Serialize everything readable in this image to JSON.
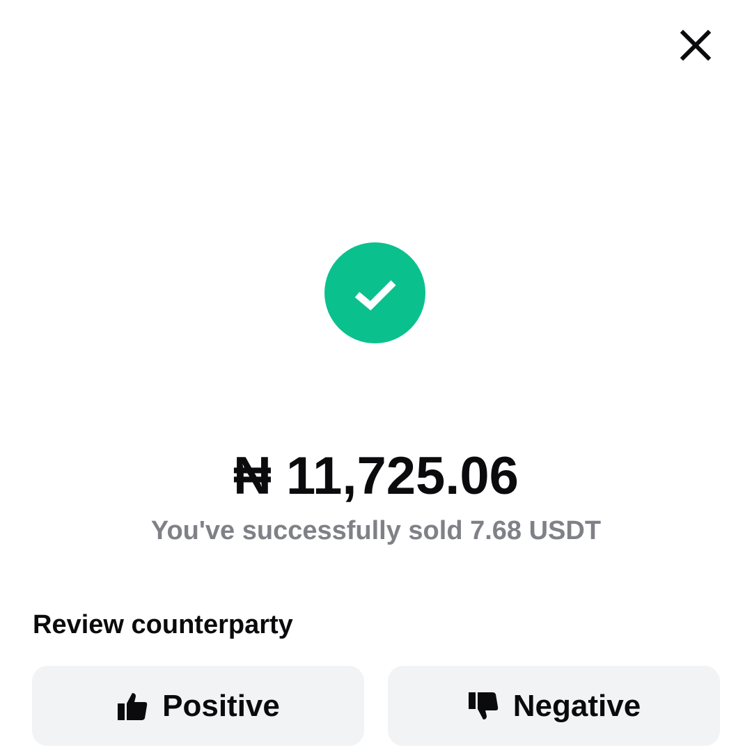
{
  "header": {
    "close_icon": "close-icon"
  },
  "status": {
    "icon": "checkmark-icon",
    "color": "#0ac18e"
  },
  "summary": {
    "amount": "₦ 11,725.06",
    "message": "You've successfully sold 7.68 USDT"
  },
  "review": {
    "heading": "Review counterparty",
    "positive_label": "Positive",
    "positive_icon": "thumbs-up-icon",
    "negative_label": "Negative",
    "negative_icon": "thumbs-down-icon"
  }
}
